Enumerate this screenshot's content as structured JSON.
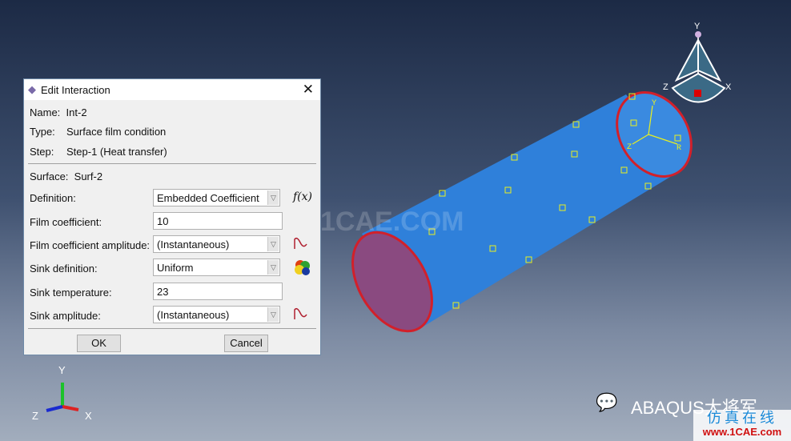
{
  "dialog": {
    "title": "Edit Interaction",
    "name_label": "Name:",
    "name_value": "Int-2",
    "type_label": "Type:",
    "type_value": "Surface film condition",
    "step_label": "Step:",
    "step_value": "Step-1 (Heat transfer)",
    "surface_label": "Surface:",
    "surface_value": "Surf-2",
    "fields": [
      {
        "label": "Definition:",
        "value": "Embedded Coefficient",
        "kind": "combo",
        "icon": "function-fx-icon",
        "icon_text": "f(x)"
      },
      {
        "label": "Film coefficient:",
        "value": "10",
        "kind": "text"
      },
      {
        "label": "Film coefficient amplitude:",
        "value": "(Instantaneous)",
        "kind": "combo",
        "icon": "amplitude-icon"
      },
      {
        "label": "Sink definition:",
        "value": "Uniform",
        "kind": "combo",
        "icon": "analytical-field-icon"
      },
      {
        "label": "Sink temperature:",
        "value": "23",
        "kind": "text"
      },
      {
        "label": "Sink amplitude:",
        "value": "(Instantaneous)",
        "kind": "combo",
        "icon": "amplitude-icon"
      }
    ],
    "ok_label": "OK",
    "cancel_label": "Cancel"
  },
  "triad": {
    "x": "X",
    "y": "Y",
    "z": "Z"
  },
  "csys": {
    "r": "R",
    "y": "Y",
    "z": "Z"
  },
  "watermarks": {
    "center": "1CAE.COM",
    "brand": "ABAQUS大将军",
    "site_cn": "仿真在线",
    "site_url": "www.1CAE.com"
  },
  "colors": {
    "part": "#2d7fd8",
    "edge": "#d2202a",
    "marker": "#e8f020"
  }
}
